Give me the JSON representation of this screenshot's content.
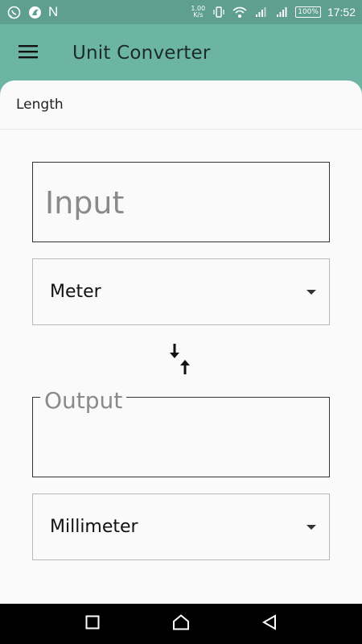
{
  "status_bar": {
    "left_icons": [
      "whatsapp-icon",
      "app-icon",
      "n-letter"
    ],
    "n_letter": "N",
    "net_speed_value": "1.00",
    "net_speed_unit": "K/s",
    "battery": "100%",
    "time": "17:52"
  },
  "app_bar": {
    "title": "Unit Converter",
    "menu_icon": "hamburger-menu-icon",
    "color": "#6cb5a5"
  },
  "category": {
    "label": "Length"
  },
  "input": {
    "placeholder": "Input",
    "value": ""
  },
  "from_unit": {
    "selected": "Meter"
  },
  "swap": {
    "icon": "swap-vertical-icon"
  },
  "output": {
    "label": "Output",
    "value": ""
  },
  "to_unit": {
    "selected": "Millimeter"
  },
  "nav_bar": {
    "buttons": [
      "recents-icon",
      "home-icon",
      "back-icon"
    ]
  }
}
